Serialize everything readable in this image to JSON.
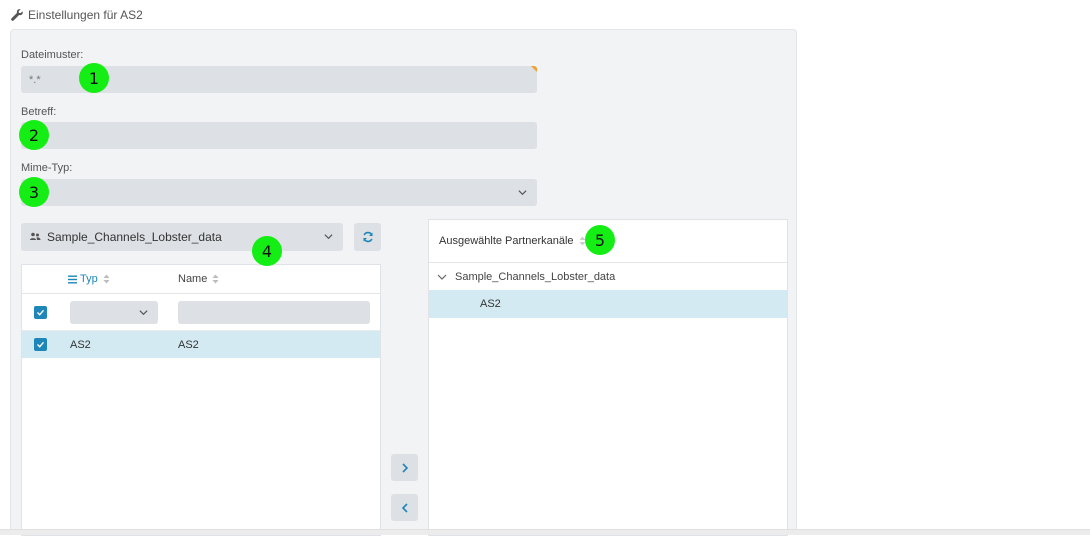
{
  "header": {
    "title": "Einstellungen für AS2",
    "icon": "wrench-icon"
  },
  "form": {
    "dateimuster_label": "Dateimuster:",
    "dateimuster_value": "*.*",
    "betreff_label": "Betreff:",
    "betreff_value": "",
    "mime_label": "Mime-Typ:",
    "mime_value": ""
  },
  "left": {
    "group_select_value": "Sample_Channels_Lobster_data",
    "columns": {
      "typ": "Typ",
      "name": "Name"
    },
    "rows": [
      {
        "typ": "AS2",
        "name": "AS2",
        "checked": true
      }
    ]
  },
  "right": {
    "header": "Ausgewählte Partnerkanäle",
    "tree_parent": "Sample_Channels_Lobster_data",
    "tree_child": "AS2"
  },
  "markers": [
    "1",
    "2",
    "3",
    "4",
    "5"
  ],
  "colors": {
    "accent": "#1f86b8",
    "selected_row": "#d3eaf2",
    "marker": "#14ee14"
  }
}
